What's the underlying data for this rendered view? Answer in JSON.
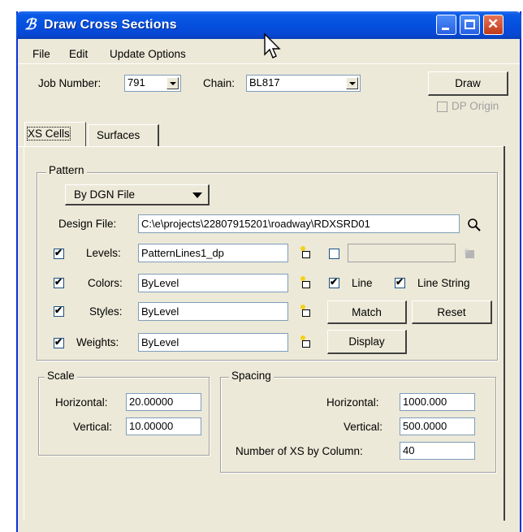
{
  "window": {
    "title": "Draw Cross Sections"
  },
  "menu": [
    "File",
    "Edit",
    "Update Options"
  ],
  "job": {
    "label": "Job Number:",
    "value": "791"
  },
  "chain": {
    "label": "Chain:",
    "value": "BL817"
  },
  "draw_button": "Draw",
  "dp_origin": {
    "label": "DP Origin",
    "checked": false,
    "enabled": false
  },
  "tabs": [
    "XS Cells",
    "Surfaces"
  ],
  "pattern": {
    "title": "Pattern",
    "mode": "By DGN File",
    "design_file_label": "Design File:",
    "design_file_value": "C:\\e\\projects\\22807915201\\roadway\\RDXSRD01",
    "levels": {
      "label": "Levels:",
      "value": "PatternLines1_dp",
      "checked": true,
      "extra_value": "",
      "extra_checked": false
    },
    "colors": {
      "label": "Colors:",
      "value": "ByLevel",
      "checked": true
    },
    "styles": {
      "label": "Styles:",
      "value": "ByLevel",
      "checked": true
    },
    "weights": {
      "label": "Weights:",
      "value": "ByLevel",
      "checked": true
    },
    "line": {
      "label": "Line",
      "checked": true
    },
    "line_string": {
      "label": "Line String",
      "checked": true
    },
    "match_button": "Match",
    "reset_button": "Reset",
    "display_button": "Display"
  },
  "scale": {
    "title": "Scale",
    "horizontal_label": "Horizontal:",
    "horizontal_value": "20.00000",
    "vertical_label": "Vertical:",
    "vertical_value": "10.00000"
  },
  "spacing": {
    "title": "Spacing",
    "horizontal_label": "Horizontal:",
    "horizontal_value": "1000.000",
    "vertical_label": "Vertical:",
    "vertical_value": "500.0000",
    "columns_label": "Number of XS by Column:",
    "columns_value": "40"
  },
  "colors": {
    "titlebar": "#0550de",
    "window_bg": "#ece9d8",
    "close_button": "#c13a18"
  }
}
